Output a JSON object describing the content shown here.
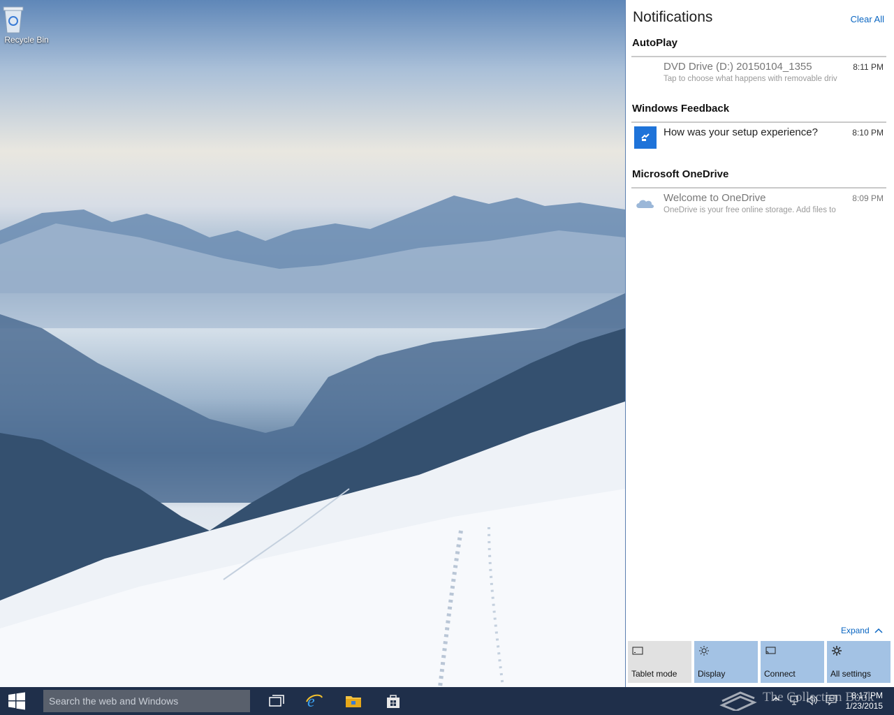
{
  "desktop": {
    "recycle_bin_label": "Recycle Bin"
  },
  "action_center": {
    "title": "Notifications",
    "clear_all": "Clear All",
    "groups": [
      {
        "name": "AutoPlay",
        "notifications": [
          {
            "title": "DVD Drive (D:) 20150104_1355",
            "body": "Tap to choose what happens with removable driv",
            "time": "8:11 PM",
            "icon": "dvd-drive-icon"
          }
        ]
      },
      {
        "name": "Windows Feedback",
        "notifications": [
          {
            "title": "How was your setup experience?",
            "body": "",
            "time": "8:10 PM",
            "icon": "feedback-icon"
          }
        ]
      },
      {
        "name": "Microsoft OneDrive",
        "notifications": [
          {
            "title": "Welcome to OneDrive",
            "body": "OneDrive is your free online storage. Add files to",
            "time": "8:09 PM",
            "icon": "onedrive-cloud-icon"
          }
        ]
      }
    ],
    "expand_label": "Expand",
    "quick_actions": [
      {
        "label": "Tablet mode",
        "icon": "tablet-icon",
        "state": "off"
      },
      {
        "label": "Display",
        "icon": "brightness-icon",
        "state": "on"
      },
      {
        "label": "Connect",
        "icon": "connect-icon",
        "state": "on"
      },
      {
        "label": "All settings",
        "icon": "gear-icon",
        "state": "on"
      }
    ]
  },
  "taskbar": {
    "search_placeholder": "Search the web and Windows",
    "pinned": [
      "task-view-icon",
      "internet-explorer-icon",
      "file-explorer-icon",
      "store-icon"
    ],
    "clock_time": "8:17 PM",
    "clock_date": "1/23/2015",
    "accent_color": "#1e73d9",
    "taskbar_color": "#1f2f4a"
  },
  "watermark": {
    "text": "The Collection Book"
  }
}
